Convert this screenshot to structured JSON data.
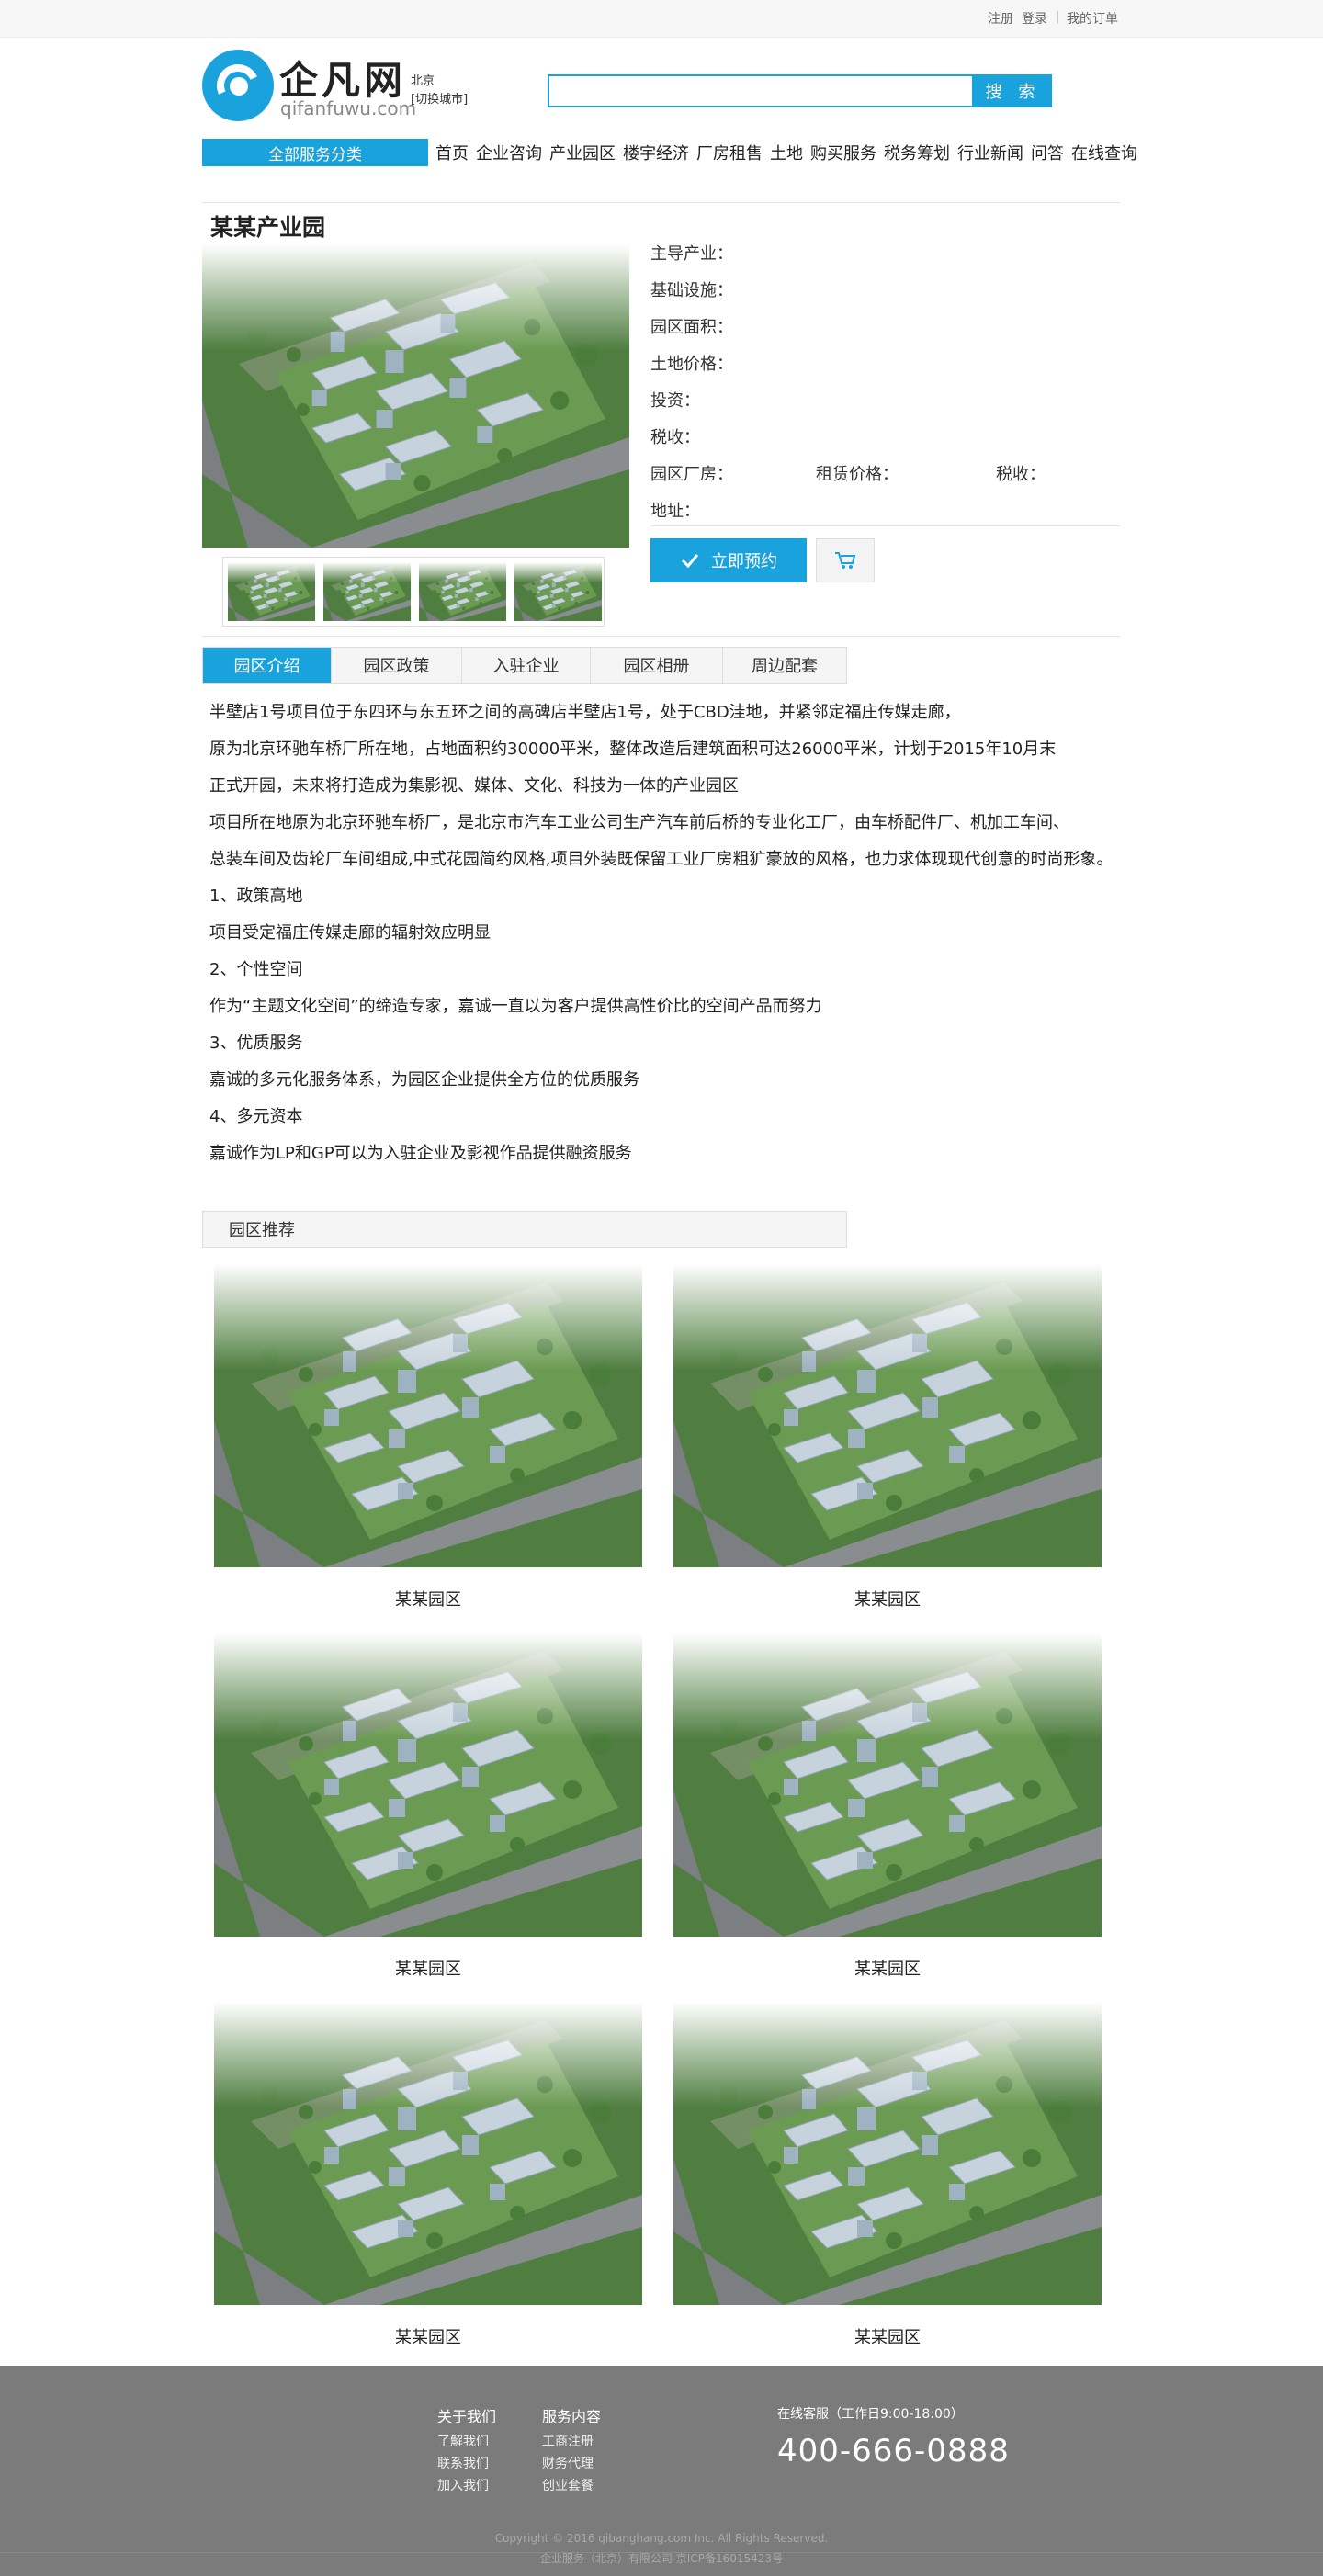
{
  "topbar": {
    "register": "注册",
    "login": "登录",
    "orders": "我的订单"
  },
  "header": {
    "logo_text": "企凡网",
    "logo_url": "qifanfuwu.com",
    "city": "北京",
    "switch_city": "[切换城市]",
    "search_placeholder": "",
    "search_label": "搜 索"
  },
  "nav": {
    "all_categories": "全部服务分类",
    "items": [
      "首页",
      "企业咨询",
      "产业园区",
      "楼宇经济",
      "厂房租售",
      "土地",
      "购买服务",
      "税务筹划",
      "行业新闻",
      "问答",
      "在线查询"
    ]
  },
  "product": {
    "title": "某某产业园",
    "fields": {
      "industry": "主导产业：",
      "facilities": "基础设施：",
      "area": "园区面积：",
      "land_price": "土地价格：",
      "investment": "投资：",
      "tax": "税收：",
      "factory": "园区厂房：",
      "rent_price": "租赁价格：",
      "tax2": "税收：",
      "address": "地址："
    },
    "book_label": "立即预约"
  },
  "tabs": [
    "园区介绍",
    "园区政策",
    "入驻企业",
    "园区相册",
    "周边配套"
  ],
  "description": [
    "半壁店1号项目位于东四环与东五环之间的高碑店半壁店1号，处于CBD洼地，并紧邻定福庄传媒走廊，",
    "原为北京环驰车桥厂所在地，占地面积约30000平米，整体改造后建筑面积可达26000平米，计划于2015年10月末",
    "正式开园，未来将打造成为集影视、媒体、文化、科技为一体的产业园区",
    "项目所在地原为北京环驰车桥厂，是北京市汽车工业公司生产汽车前后桥的专业化工厂，由车桥配件厂、机加工车间、",
    "总装车间及齿轮厂车间组成,中式花园简约风格,项目外装既保留工业厂房粗犷豪放的风格，也力求体现现代创意的时尚形象。",
    "1、政策高地",
    "项目受定福庄传媒走廊的辐射效应明显",
    "2、个性空间",
    "作为“主题文化空间”的缔造专家，嘉诚一直以为客户提供高性价比的空间产品而努力",
    "3、优质服务",
    "嘉诚的多元化服务体系，为园区企业提供全方位的优质服务",
    "4、多元资本",
    "嘉诚作为LP和GP可以为入驻企业及影视作品提供融资服务"
  ],
  "recommend": {
    "title": "园区推荐",
    "cards": [
      "某某园区",
      "某某园区",
      "某某园区",
      "某某园区",
      "某某园区",
      "某某园区"
    ]
  },
  "footer": {
    "about_title": "关于我们",
    "about_items": [
      "了解我们",
      "联系我们",
      "加入我们"
    ],
    "service_title": "服务内容",
    "service_items": [
      "工商注册",
      "财务代理",
      "创业套餐"
    ],
    "hours": "在线客服（工作日9:00-18:00）",
    "phone": "400-666-0888",
    "copyright": "Copyright © 2016 qibanghang.com Inc. All Rights Reserved.",
    "company": "企业服务（北京）有限公司 京ICP备16015423号"
  },
  "colors": {
    "accent": "#1aa2dd",
    "footer_bg": "#7b7b7b"
  }
}
